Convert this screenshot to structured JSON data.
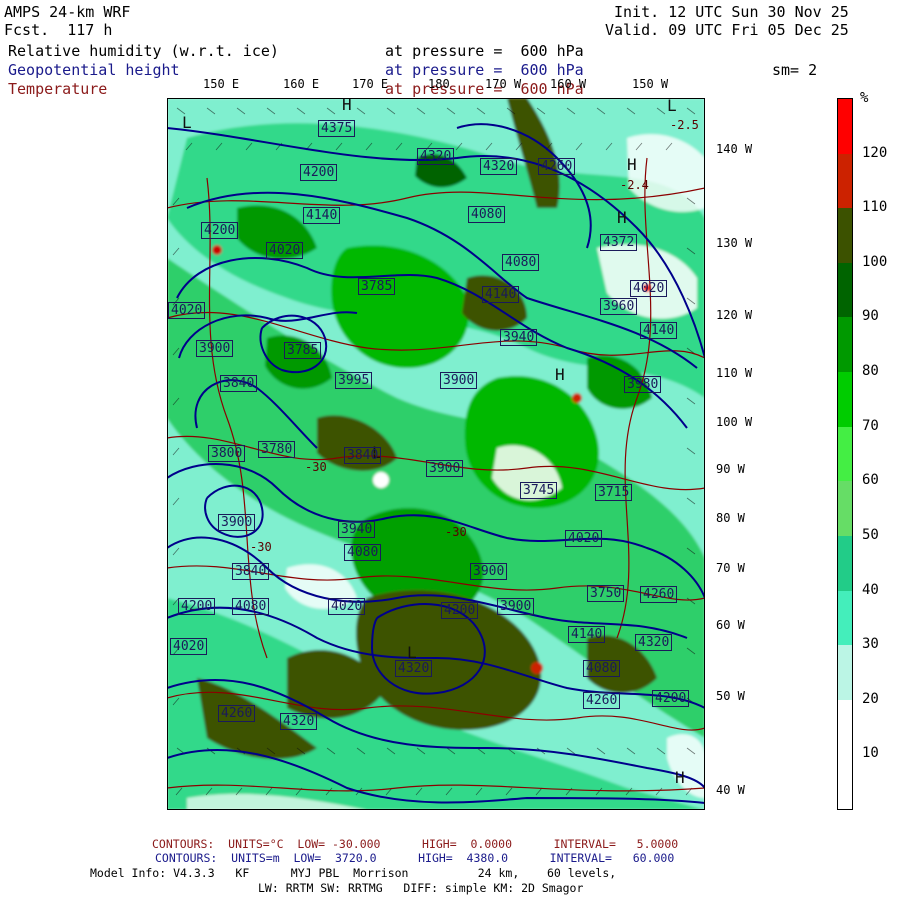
{
  "header": {
    "model": "AMPS 24-km WRF",
    "fcst": "Fcst.  117 h",
    "init": "Init. 12 UTC Sun 30 Nov 25",
    "valid": "Valid. 09 UTC Fri 05 Dec 25",
    "field1": "Relative humidity (w.r.t. ice)",
    "field2": "Geopotential height",
    "field3": "Temperature",
    "level1": "at pressure =  600 hPa",
    "level2": "at pressure =  600 hPa",
    "level3": "at pressure =  600 hPa",
    "smoothing": "sm= 2"
  },
  "lon_labels_top": [
    "150 E",
    "160 E",
    "170 E",
    "180",
    "170 W",
    "160 W",
    "150 W"
  ],
  "lon_labels_right": [
    "140 W",
    "130 W",
    "120 W",
    "110 W",
    "100 W",
    "90 W",
    "80 W",
    "70 W",
    "60 W",
    "50 W",
    "40 W"
  ],
  "colorbar": {
    "unit": "%",
    "labels": [
      "120",
      "110",
      "100",
      "90",
      "80",
      "70",
      "60",
      "50",
      "40",
      "30",
      "20",
      "10"
    ],
    "colors": [
      "#ff0000",
      "#cc2200",
      "#3c5200",
      "#006400",
      "#009900",
      "#00cc00",
      "#44ee44",
      "#66dd66",
      "#22cc88",
      "#44eebb",
      "#bbf5e5",
      "#ffffff",
      "#ffffff"
    ]
  },
  "height_labels": [
    "4375",
    "4320",
    "4200",
    "4320",
    "4080",
    "4260",
    "4372",
    "4140",
    "4200",
    "4020",
    "4080",
    "4020",
    "3785",
    "4140",
    "3960",
    "4020",
    "4140",
    "3940",
    "3900",
    "3785",
    "3980",
    "3840",
    "3995",
    "3900",
    "3800",
    "3780",
    "3840",
    "3900",
    "3745",
    "3715",
    "3900",
    "3940",
    "4080",
    "4020",
    "3840",
    "3900",
    "3900",
    "3750",
    "4020",
    "4200",
    "4080",
    "4200",
    "4020",
    "4140",
    "4320",
    "4260",
    "4080",
    "4260",
    "4200",
    "4320",
    "4260",
    "4320"
  ],
  "temp_labels": [
    "-2.5",
    "-2.4",
    "-30",
    "-30",
    "-30"
  ],
  "footer": {
    "contours1": "CONTOURS:  UNITS=°C  LOW= -30.000      HIGH=  0.0000      INTERVAL=   5.0000",
    "contours2": "CONTOURS:  UNITS=m  LOW=  3720.0      HIGH=  4380.0      INTERVAL=   60.000",
    "model_info": "Model Info: V4.3.3   KF      MYJ PBL  Morrison          24 km,    60 levels,",
    "physics": "LW: RRTM SW: RRTMG   DIFF: simple KM: 2D Smagor"
  }
}
